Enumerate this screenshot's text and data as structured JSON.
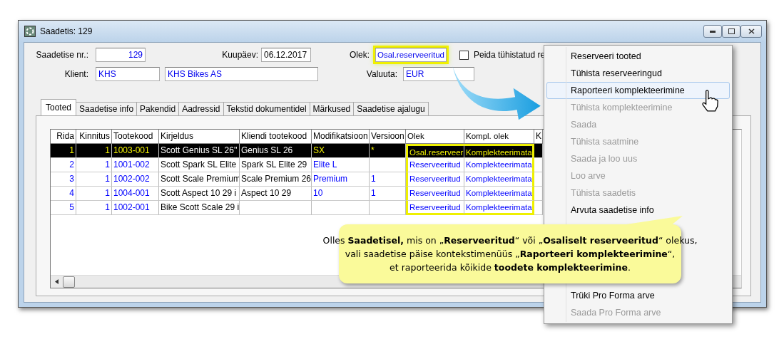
{
  "window": {
    "title": "Saadetis: 129"
  },
  "header": {
    "number": {
      "label": "Saadetise nr.:",
      "value": "129"
    },
    "date": {
      "label": "Kuupäev:",
      "value": "06.12.2017"
    },
    "status": {
      "label": "Olek:",
      "value": "Osal.reserveeritud",
      "highlighted": true
    },
    "hide_cancelled": {
      "label": "Peida tühistatud re",
      "checked": false
    },
    "client": {
      "label": "Klient:",
      "code": "KHS",
      "name": "KHS Bikes AS"
    },
    "currency": {
      "label": "Valuuta:",
      "value": "EUR"
    }
  },
  "tabs": [
    {
      "label": "Tooted",
      "selected": true
    },
    {
      "label": "Saadetise info",
      "selected": false
    },
    {
      "label": "Pakendid",
      "selected": false
    },
    {
      "label": "Aadressid",
      "selected": false
    },
    {
      "label": "Tekstid dokumentidel",
      "selected": false
    },
    {
      "label": "Märkused",
      "selected": false
    },
    {
      "label": "Saadetise ajalugu",
      "selected": false
    }
  ],
  "table": {
    "columns": [
      {
        "label": "Rida",
        "highlighted": false
      },
      {
        "label": "Kinnitus",
        "highlighted": false
      },
      {
        "label": "Tootekood",
        "highlighted": false
      },
      {
        "label": "Kirjeldus",
        "highlighted": false
      },
      {
        "label": "Kliendi tootekood",
        "highlighted": false
      },
      {
        "label": "Modifikatsioon",
        "highlighted": false
      },
      {
        "label": "Versioon",
        "highlighted": false
      },
      {
        "label": "Olek",
        "highlighted": true
      },
      {
        "label": "Kompl. olek",
        "highlighted": true
      },
      {
        "label": "K",
        "highlighted": false
      }
    ],
    "rows": [
      {
        "selected": true,
        "cells": [
          "1",
          "1",
          "1003-001",
          "Scott Genius SL 26''",
          "Genius SL 26",
          "SX",
          "*",
          "Osal.reserveeri",
          "Komplekteerimata",
          ""
        ]
      },
      {
        "selected": false,
        "cells": [
          "2",
          "1",
          "1001-002",
          "Scott Spark SL Elite",
          "Spark SL Elite 29",
          "Elite L",
          "",
          "Reserveeritud",
          "Komplekteerimata",
          ""
        ]
      },
      {
        "selected": false,
        "cells": [
          "3",
          "1",
          "1002-002",
          "Scott Scale Premium",
          "Scale Premium 26",
          "Premium",
          "1",
          "Reserveeritud",
          "Komplekteerimata",
          ""
        ]
      },
      {
        "selected": false,
        "cells": [
          "4",
          "1",
          "1004-001",
          "Scott Aspect 10 29 i",
          "Aspect 10 29",
          "10",
          "1",
          "Reserveeritud",
          "Komplekteerimata",
          ""
        ]
      },
      {
        "selected": false,
        "cells": [
          "5",
          "1",
          "1002-001",
          "Bike Scott Scale 29 i",
          "",
          "",
          "",
          "Reserveeritud",
          "Komplekteerimata",
          ""
        ]
      }
    ]
  },
  "context_menu": {
    "items": [
      {
        "label": "Reserveeri tooted",
        "disabled": false,
        "selected": false
      },
      {
        "label": "Tühista reserveeringud",
        "disabled": false,
        "selected": false
      },
      {
        "label": "Raporteeri komplekteerimine",
        "disabled": false,
        "selected": true
      },
      {
        "label": "Tühista komplekteerimine",
        "disabled": true,
        "selected": false
      },
      {
        "label": "Saada",
        "disabled": true,
        "selected": false
      },
      {
        "label": "Tühista saatmine",
        "disabled": true,
        "selected": false
      },
      {
        "label": "Saada ja loo uus",
        "disabled": true,
        "selected": false
      },
      {
        "label": "Loo arve",
        "disabled": true,
        "selected": false
      },
      {
        "label": "Tühista saadetis",
        "disabled": true,
        "selected": false
      },
      {
        "label": "Arvuta saadetise info",
        "disabled": false,
        "selected": false
      }
    ],
    "items_after": [
      {
        "label": "Trüki Pro Forma arve",
        "disabled": false,
        "selected": false
      },
      {
        "label": "Saada Pro Forma arve",
        "disabled": true,
        "selected": false
      }
    ]
  },
  "callout": {
    "lines": [
      "Olles **Saadetisel,** mis on „**Reserveeritud**“ või „**Osaliselt reserveeritud**“ olekus,",
      "vali saadetise päise kontekstimenüüs „**Raporteeri komplekteerimine**“,",
      "et raporteerida kõikide **toodete komplekteerimine**."
    ]
  }
}
